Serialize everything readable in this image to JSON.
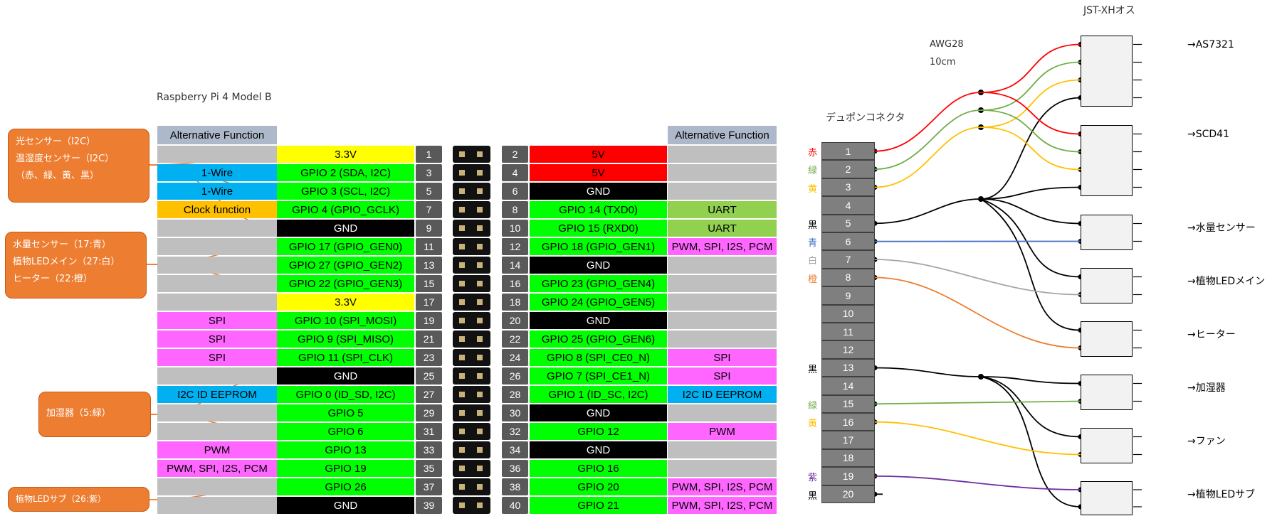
{
  "board_title": "Raspberry Pi 4 Model B",
  "alt_header": "Alternative Function",
  "left_rows": [
    {
      "pin": "1",
      "name": "3.3V",
      "alt": ""
    },
    {
      "pin": "3",
      "name": "GPIO 2 (SDA,  I2C)",
      "alt": "1-Wire"
    },
    {
      "pin": "5",
      "name": "GPIO 3 (SCL,  I2C)",
      "alt": "1-Wire"
    },
    {
      "pin": "7",
      "name": "GPIO 4 (GPIO_GCLK)",
      "alt": "Clock function"
    },
    {
      "pin": "9",
      "name": "GND",
      "alt": ""
    },
    {
      "pin": "11",
      "name": "GPIO 17 (GPIO_GEN0)",
      "alt": ""
    },
    {
      "pin": "13",
      "name": "GPIO 27 (GPIO_GEN2)",
      "alt": ""
    },
    {
      "pin": "15",
      "name": "GPIO 22 (GPIO_GEN3)",
      "alt": ""
    },
    {
      "pin": "17",
      "name": "3.3V",
      "alt": ""
    },
    {
      "pin": "19",
      "name": "GPIO 10 (SPI_MOSI)",
      "alt": "SPI"
    },
    {
      "pin": "21",
      "name": "GPIO 9 (SPI_MISO)",
      "alt": "SPI"
    },
    {
      "pin": "23",
      "name": "GPIO 11 (SPI_CLK)",
      "alt": "SPI"
    },
    {
      "pin": "25",
      "name": "GND",
      "alt": ""
    },
    {
      "pin": "27",
      "name": "GPIO 0 (ID_SD,  I2C)",
      "alt": "I2C ID EEPROM"
    },
    {
      "pin": "29",
      "name": "GPIO 5",
      "alt": ""
    },
    {
      "pin": "31",
      "name": "GPIO 6",
      "alt": ""
    },
    {
      "pin": "33",
      "name": "GPIO 13",
      "alt": "PWM"
    },
    {
      "pin": "35",
      "name": "GPIO 19",
      "alt": "PWM, SPI, I2S, PCM"
    },
    {
      "pin": "37",
      "name": "GPIO 26",
      "alt": ""
    },
    {
      "pin": "39",
      "name": "GND",
      "alt": ""
    }
  ],
  "right_rows": [
    {
      "pin": "2",
      "name": "5V",
      "alt": ""
    },
    {
      "pin": "4",
      "name": "5V",
      "alt": ""
    },
    {
      "pin": "6",
      "name": "GND",
      "alt": ""
    },
    {
      "pin": "8",
      "name": "GPIO 14 (TXD0)",
      "alt": "UART"
    },
    {
      "pin": "10",
      "name": "GPIO 15 (RXD0)",
      "alt": "UART"
    },
    {
      "pin": "12",
      "name": "GPIO 18 (GPIO_GEN1)",
      "alt": "PWM, SPI, I2S, PCM"
    },
    {
      "pin": "14",
      "name": "GND",
      "alt": ""
    },
    {
      "pin": "16",
      "name": "GPIO 23 (GPIO_GEN4)",
      "alt": ""
    },
    {
      "pin": "18",
      "name": "GPIO 24 (GPIO_GEN5)",
      "alt": ""
    },
    {
      "pin": "20",
      "name": "GND",
      "alt": ""
    },
    {
      "pin": "22",
      "name": "GPIO 25 (GPIO_GEN6)",
      "alt": ""
    },
    {
      "pin": "24",
      "name": "GPIO 8 (SPI_CE0_N)",
      "alt": "SPI"
    },
    {
      "pin": "26",
      "name": "GPIO 7 (SPI_CE1_N)",
      "alt": "SPI"
    },
    {
      "pin": "28",
      "name": "GPIO 1 (ID_SC,  I2C)",
      "alt": "I2C ID EEPROM"
    },
    {
      "pin": "30",
      "name": "GND",
      "alt": ""
    },
    {
      "pin": "32",
      "name": "GPIO 12",
      "alt": "PWM"
    },
    {
      "pin": "34",
      "name": "GND",
      "alt": ""
    },
    {
      "pin": "36",
      "name": "GPIO 16",
      "alt": ""
    },
    {
      "pin": "38",
      "name": "GPIO 20",
      "alt": "PWM, SPI, I2S, PCM"
    },
    {
      "pin": "40",
      "name": "GPIO 21",
      "alt": "PWM, SPI, I2S, PCM"
    }
  ],
  "callouts": {
    "light": "光センサー（I2C）\n温湿度センサー（I2C）\n（赤、緑、黄、黒）",
    "water": "水量センサー（17:青）\n植物LEDメイン（27:白）\nヒーター（22:橙）",
    "humidifier": "加湿器（5:緑）",
    "led_sub": "植物LEDサブ（26:紫）"
  },
  "dupont_title": "デュポンコネクタ",
  "awg": "AWG28",
  "length": "10cm",
  "jst_title": "JST-XHオス",
  "dupont_pins": [
    "1",
    "2",
    "3",
    "4",
    "5",
    "6",
    "7",
    "8",
    "9",
    "10",
    "11",
    "12",
    "13",
    "14",
    "15",
    "16",
    "17",
    "18",
    "19",
    "20"
  ],
  "wire_color_labels": [
    "赤",
    "緑",
    "黄",
    "",
    "黒",
    "青",
    "白",
    "橙",
    "",
    "",
    "",
    "",
    "黒",
    "",
    "緑",
    "黄",
    "",
    "",
    "紫",
    "黒"
  ],
  "destinations": [
    "→AS7321",
    "→SCD41",
    "→水量センサー",
    "→植物LEDメイン",
    "→ヒーター",
    "→加湿器",
    "→ファン",
    "→植物LEDサブ"
  ],
  "colors": {
    "green": "#00ff00",
    "yellow": "#ffff00",
    "red": "#ff0000",
    "black": "#000000",
    "pin_gray": "#595959",
    "alt_gray": "#bfbfbf",
    "header_gray": "#adb9ca",
    "blue": "#00b0f0",
    "orange": "#ffc000",
    "magenta": "#ff66ff",
    "uart": "#92d050",
    "callout": "#ed7d31"
  }
}
